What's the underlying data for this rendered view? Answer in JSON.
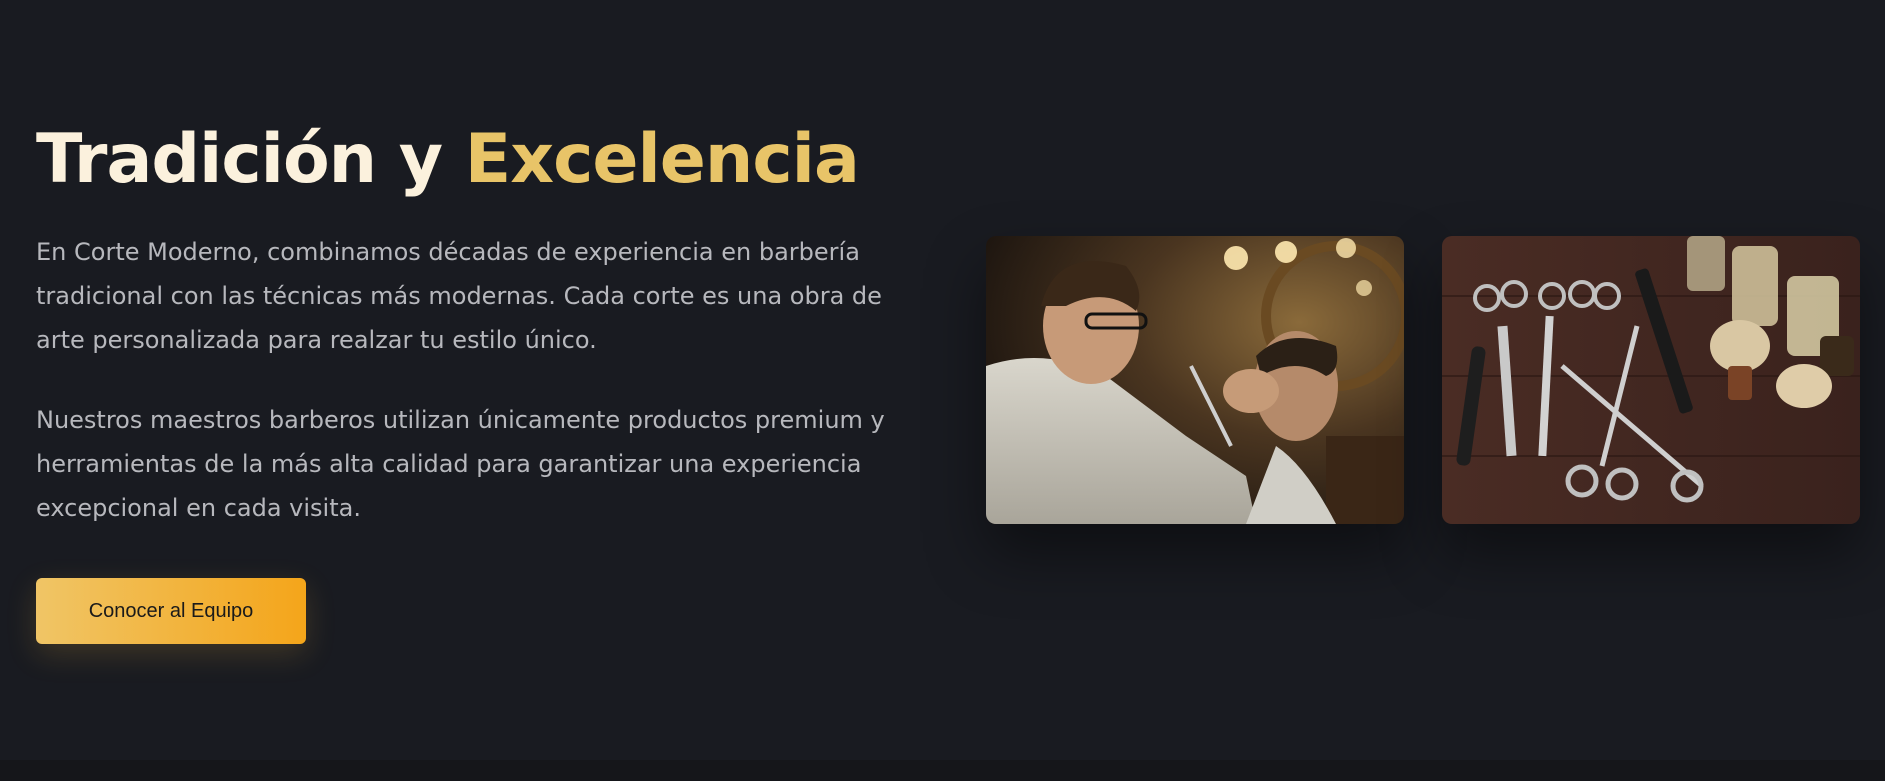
{
  "hero": {
    "title_main": "Tradición y ",
    "title_accent": "Excelencia",
    "paragraph_1": "En Corte Moderno, combinamos décadas de experiencia en barbería tradicional con las técnicas más modernas. Cada corte es una obra de arte personalizada para realzar tu estilo único.",
    "paragraph_2": "Nuestros maestros barberos utilizan únicamente productos premium y herramientas de la más alta calidad para garantizar una experiencia excepcional en cada visita.",
    "cta_label": "Conocer al Equipo"
  },
  "colors": {
    "background": "#191b21",
    "title": "#fbf1dd",
    "accent": "#e8c468",
    "body_text": "#b7b8bd",
    "cta_gradient_start": "#f0c566",
    "cta_gradient_end": "#f4a51a"
  },
  "images": [
    {
      "name": "barber-cutting-hair-image"
    },
    {
      "name": "barber-tools-image"
    }
  ]
}
